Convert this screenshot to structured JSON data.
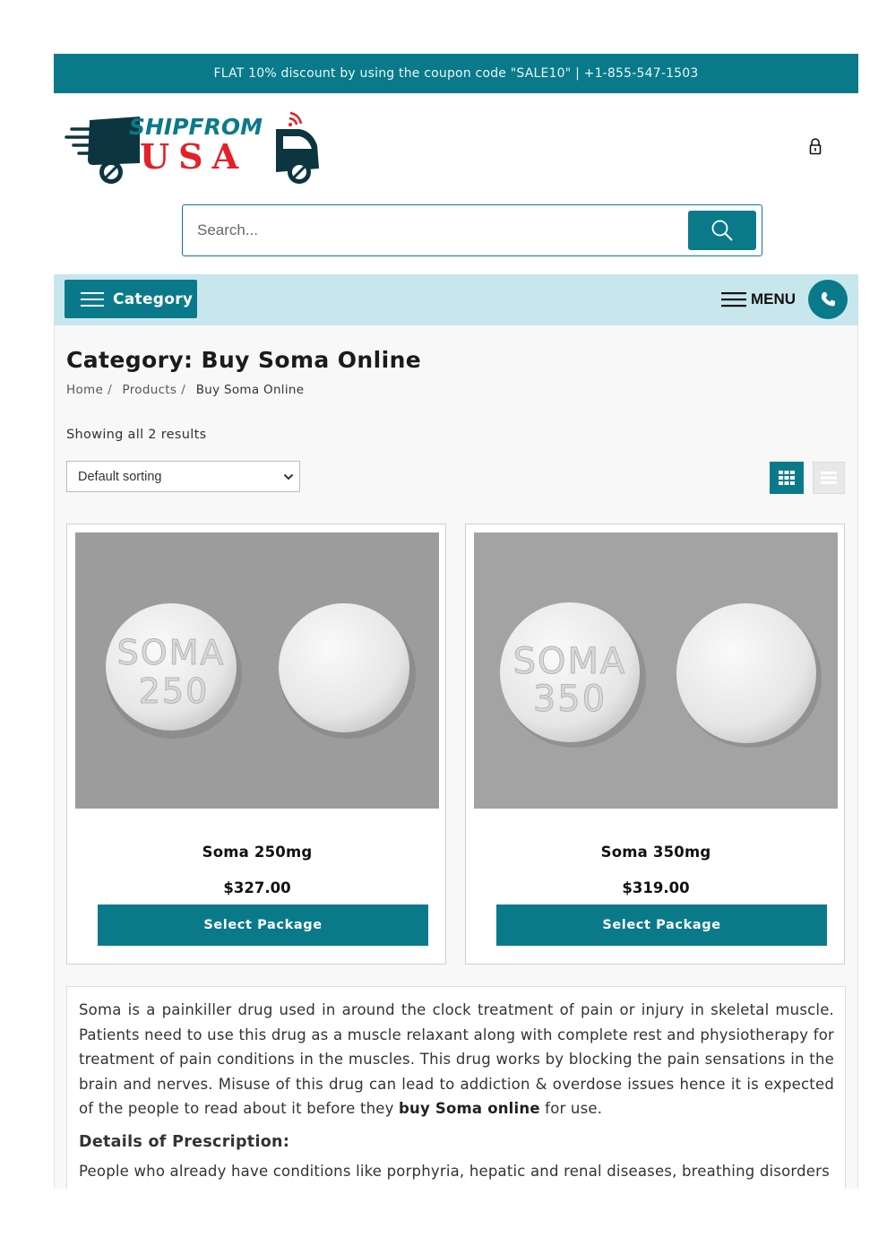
{
  "promo": {
    "text": "FLAT 10% discount by using the coupon code \"SALE10\" | +1-855-547-1503"
  },
  "logo": {
    "top": "SHIPFROM",
    "bottom": "USA"
  },
  "search": {
    "placeholder": "Search..."
  },
  "nav": {
    "category_label": "Category",
    "menu_label": "MENU"
  },
  "page": {
    "title": "Category: Buy Soma Online",
    "breadcrumb": [
      "Home",
      "Products",
      "Buy Soma Online"
    ],
    "result_count": "Showing all 2 results",
    "sort_selected": "Default sorting"
  },
  "products": [
    {
      "name": "Soma 250mg",
      "price": "$327.00",
      "button": "Select Package",
      "pill_text": [
        "SOMA",
        "250"
      ]
    },
    {
      "name": "Soma 350mg",
      "price": "$319.00",
      "button": "Select Package",
      "pill_text": [
        "SOMA",
        "350"
      ]
    }
  ],
  "description": {
    "p1_before": "Soma is a painkiller drug used in around the clock treatment of pain or injury in skeletal muscle. Patients need to use this drug as a muscle relaxant along with complete rest and physiotherapy for treatment of pain conditions in the muscles. This drug works by blocking the pain sensations in the brain and nerves. Misuse of this drug can lead to addiction & overdose issues hence it is expected of the people to read about it before they ",
    "p1_bold": "buy Soma online",
    "p1_after": " for use.",
    "heading": "Details of Prescription:",
    "p2": "People who already have conditions like porphyria, hepatic and renal diseases, breathing disorders"
  },
  "colors": {
    "brand": "#0a7a8a",
    "nav_bg": "#c8e7ec",
    "logo_red": "#e4202a",
    "logo_dark": "#0c3540"
  },
  "icons": [
    "lock-icon",
    "search-icon",
    "hamburger-icon",
    "phone-icon",
    "grid-view-icon",
    "list-view-icon",
    "chevron-down-icon"
  ]
}
